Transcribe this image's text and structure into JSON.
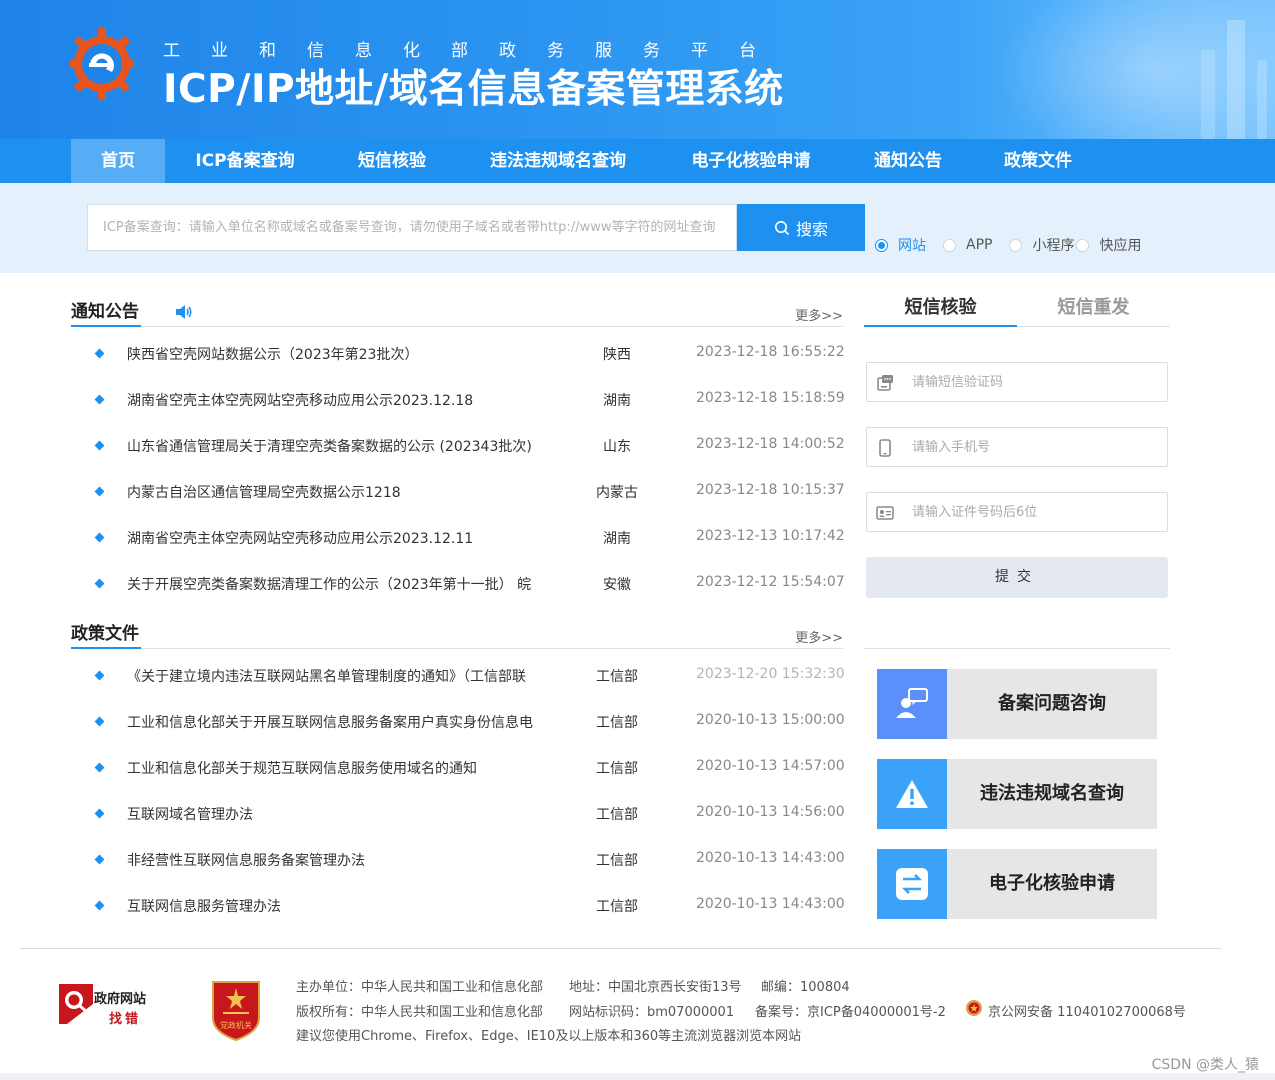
{
  "header": {
    "subtitle": "工业和信息化部政务服务平台",
    "title": "ICP/IP地址/域名信息备案管理系统"
  },
  "nav": [
    {
      "label": "首页",
      "active": true
    },
    {
      "label": "ICP备案查询"
    },
    {
      "label": "短信核验"
    },
    {
      "label": "违法违规域名查询"
    },
    {
      "label": "电子化核验申请"
    },
    {
      "label": "通知公告"
    },
    {
      "label": "政策文件"
    }
  ],
  "search": {
    "placeholder": "ICP备案查询：请输入单位名称或域名或备案号查询，请勿使用子域名或者带http://www等字符的网址查询",
    "button": "搜索",
    "options": [
      {
        "label": "网站",
        "checked": true
      },
      {
        "label": "APP",
        "checked": false
      },
      {
        "label": "小程序",
        "checked": false
      },
      {
        "label": "快应用",
        "checked": false
      }
    ]
  },
  "notices": {
    "title": "通知公告",
    "more": "更多>>",
    "rows": [
      {
        "title": "陕西省空壳网站数据公示（2023年第23批次）",
        "region": "陕西",
        "date": "2023-12-18 16:55:22"
      },
      {
        "title": "湖南省空壳主体空壳网站空壳移动应用公示2023.12.18",
        "region": "湖南",
        "date": "2023-12-18 15:18:59"
      },
      {
        "title": "山东省通信管理局关于清理空壳类备案数据的公示 (202343批次)",
        "region": "山东",
        "date": "2023-12-18 14:00:52"
      },
      {
        "title": "内蒙古自治区通信管理局空壳数据公示1218",
        "region": "内蒙古",
        "date": "2023-12-18 10:15:37"
      },
      {
        "title": "湖南省空壳主体空壳网站空壳移动应用公示2023.12.11",
        "region": "湖南",
        "date": "2023-12-13 10:17:42"
      },
      {
        "title": "关于开展空壳类备案数据清理工作的公示（2023年第十一批） 皖",
        "region": "安徽",
        "date": "2023-12-12 15:54:07"
      }
    ]
  },
  "policies": {
    "title": "政策文件",
    "more": "更多>>",
    "rows": [
      {
        "title": "《关于建立境内违法互联网站黑名单管理制度的通知》（工信部联",
        "region": "工信部",
        "date": "2023-12-20 15:32:30"
      },
      {
        "title": "工业和信息化部关于开展互联网信息服务备案用户真实身份信息电",
        "region": "工信部",
        "date": "2020-10-13 15:00:00"
      },
      {
        "title": "工业和信息化部关于规范互联网信息服务使用域名的通知",
        "region": "工信部",
        "date": "2020-10-13 14:57:00"
      },
      {
        "title": "互联网域名管理办法",
        "region": "工信部",
        "date": "2020-10-13 14:56:00"
      },
      {
        "title": "非经营性互联网信息服务备案管理办法",
        "region": "工信部",
        "date": "2020-10-13 14:43:00"
      },
      {
        "title": "互联网信息服务管理办法",
        "region": "工信部",
        "date": "2020-10-13 14:43:00"
      }
    ]
  },
  "sms": {
    "tab_active": "短信核验",
    "tab_inactive": "短信重发",
    "code_placeholder": "请输短信验证码",
    "phone_placeholder": "请输入手机号",
    "id_placeholder": "请输入证件号码后6位",
    "submit": "提交"
  },
  "cards": [
    {
      "label": "备案问题咨询",
      "icon": "consult-icon",
      "color": "#5b8ff9"
    },
    {
      "label": "违法违规域名查询",
      "icon": "warning-icon",
      "color": "#3aa2f8"
    },
    {
      "label": "电子化核验申请",
      "icon": "swap-icon",
      "color": "#3aa2f8"
    }
  ],
  "footer": {
    "gov_site": "政府网站",
    "find_error": "找错",
    "badge_text": "党政机关",
    "host": "主办单位：中华人民共和国工业和信息化部",
    "address": "地址：中国北京西长安街13号",
    "postcode": "邮编：100804",
    "copyright": "版权所有：中华人民共和国工业和信息化部",
    "site_id": "网站标识码：bm07000001",
    "icp": "备案号：京ICP备04000001号-2",
    "police": "京公网安备 11040102700068号",
    "browser_tip": "建议您使用Chrome、Firefox、Edge、IE10及以上版本和360等主流浏览器浏览本网站"
  },
  "watermark": "CSDN @类人_猿"
}
